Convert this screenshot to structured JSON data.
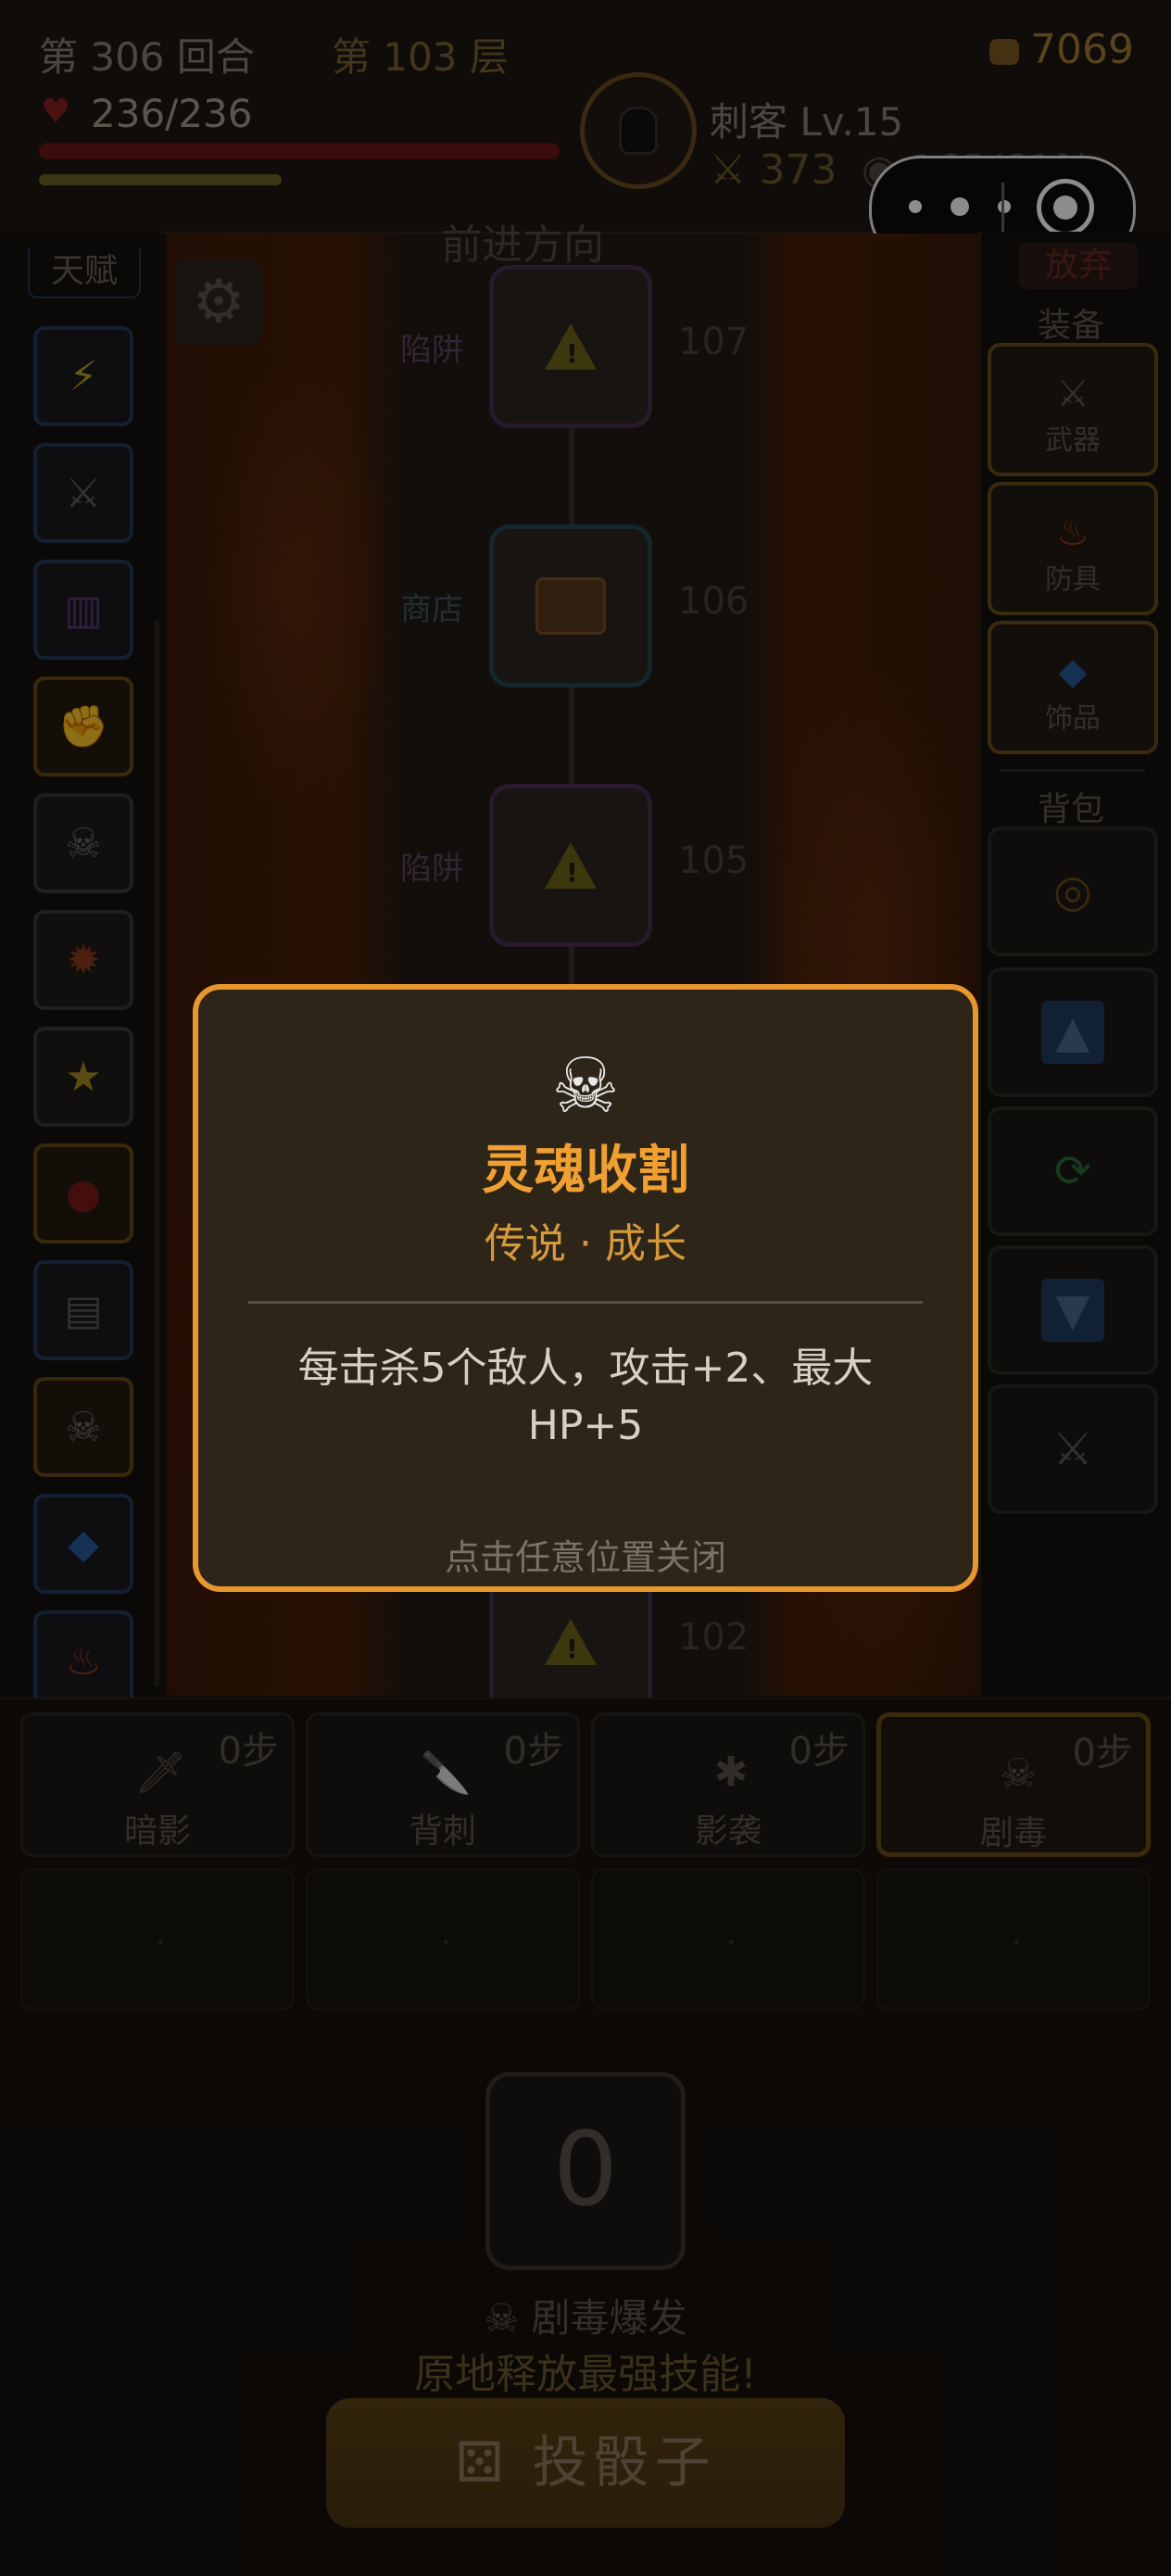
{
  "hud": {
    "turn": "第 306 回合",
    "floor": "第 103 层",
    "gold": "7069",
    "hp": "236/236",
    "hero": "刺客 Lv.15",
    "attack": "373",
    "exp": "162/61%",
    "hp_fraction": 1.0,
    "xp_fraction": 0.47
  },
  "map": {
    "nodes": [
      {
        "label": "陷阱",
        "floor": "107",
        "type": "trap",
        "icon": "warning-icon"
      },
      {
        "label": "商店",
        "floor": "106",
        "type": "shop",
        "icon": "chest-icon"
      },
      {
        "label": "陷阱",
        "floor": "105",
        "type": "trap",
        "icon": "warning-icon"
      },
      {
        "label": "",
        "floor": "102",
        "type": "trap",
        "icon": "warning-icon"
      }
    ],
    "header_partial": "前进方向"
  },
  "left": {
    "title": "天赋",
    "slots": [
      {
        "icon": "lightning-icon",
        "glyph": "⚡"
      },
      {
        "icon": "swords-icon",
        "glyph": "⚔"
      },
      {
        "icon": "books-icon",
        "glyph": "▥"
      },
      {
        "icon": "muscle-icon",
        "glyph": "✊"
      },
      {
        "icon": "skull-crossbones-icon",
        "glyph": "☠"
      },
      {
        "icon": "explosion-icon",
        "glyph": "✹"
      },
      {
        "icon": "star-frame-icon",
        "glyph": "★"
      },
      {
        "icon": "blood-drop-icon",
        "glyph": "●"
      },
      {
        "icon": "receipt-icon",
        "glyph": "▤"
      },
      {
        "icon": "skull-crossbones-icon",
        "glyph": "☠"
      },
      {
        "icon": "gem-icon",
        "glyph": "◆"
      },
      {
        "icon": "fire-icon",
        "glyph": "♨"
      }
    ]
  },
  "right": {
    "abandon": "放弃",
    "equip_title": "装备",
    "equip": [
      {
        "label": "武器",
        "icon": "swords-icon",
        "glyph": "⚔"
      },
      {
        "label": "防具",
        "icon": "fire-icon",
        "glyph": "♨"
      },
      {
        "label": "饰品",
        "icon": "gem-icon",
        "glyph": "◆"
      }
    ],
    "bag_title": "背包",
    "bag": [
      {
        "icon": "ring-icon",
        "glyph": "◎"
      },
      {
        "icon": "arrow-up-icon",
        "glyph": "▲"
      },
      {
        "icon": "refresh-icon",
        "glyph": "⟳"
      },
      {
        "icon": "arrow-down-icon",
        "glyph": "▼"
      },
      {
        "icon": "swords-icon",
        "glyph": "⚔"
      }
    ]
  },
  "skills": [
    {
      "name": "暗影",
      "steps": "0步",
      "icon": "dagger-icon",
      "glyph": "🗡"
    },
    {
      "name": "背刺",
      "steps": "0步",
      "icon": "knife-icon",
      "glyph": "🔪"
    },
    {
      "name": "影袭",
      "steps": "0步",
      "icon": "spider-icon",
      "glyph": "✱"
    },
    {
      "name": "剧毒",
      "steps": "0步",
      "icon": "skull-crossbones-icon",
      "glyph": "☠"
    }
  ],
  "bottom": {
    "dice_value": "0",
    "skill_name": "☠ 剧毒爆发",
    "skill_hint": "原地释放最强技能!",
    "roll_label": "投骰子",
    "roll_icon": "dice-icon"
  },
  "modal": {
    "icon": "skull-crossbones-icon",
    "title": "灵魂收割",
    "subtitle": "传说 · 成长",
    "description": "每击杀5个敌人，攻击+2、最大HP+5",
    "close_hint": "点击任意位置关闭"
  },
  "colors": {
    "accent": "#e8962e",
    "title": "#f0a030",
    "hp": "#6a1616"
  }
}
